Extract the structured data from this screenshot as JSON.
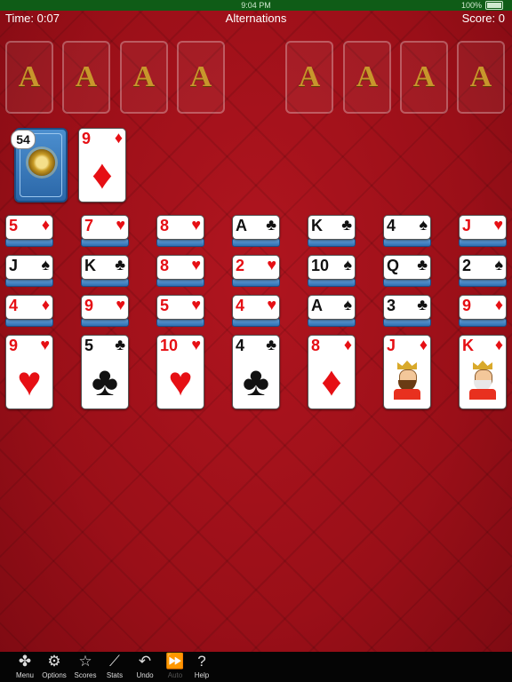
{
  "status_bar": {
    "time": "9:04 PM",
    "battery": "100%"
  },
  "header": {
    "time": "Time: 0:07",
    "title": "Alternations",
    "score": "Score: 0"
  },
  "foundations": [
    "A",
    "A",
    "A",
    "A",
    "A",
    "A",
    "A",
    "A"
  ],
  "stock": {
    "count": "54"
  },
  "waste": {
    "rank": "9",
    "suit": "♦",
    "color": "red"
  },
  "tableau": [
    {
      "cards": [
        {
          "rank": "5",
          "suit": "♦",
          "color": "red"
        },
        {
          "rank": "J",
          "suit": "♠",
          "color": "black"
        },
        {
          "rank": "4",
          "suit": "♦",
          "color": "red"
        },
        {
          "rank": "9",
          "suit": "♥",
          "color": "red"
        }
      ]
    },
    {
      "cards": [
        {
          "rank": "7",
          "suit": "♥",
          "color": "red"
        },
        {
          "rank": "K",
          "suit": "♣",
          "color": "black"
        },
        {
          "rank": "9",
          "suit": "♥",
          "color": "red"
        },
        {
          "rank": "5",
          "suit": "♣",
          "color": "black"
        }
      ]
    },
    {
      "cards": [
        {
          "rank": "8",
          "suit": "♥",
          "color": "red"
        },
        {
          "rank": "8",
          "suit": "♥",
          "color": "red"
        },
        {
          "rank": "5",
          "suit": "♥",
          "color": "red"
        },
        {
          "rank": "10",
          "suit": "♥",
          "color": "red"
        }
      ]
    },
    {
      "cards": [
        {
          "rank": "A",
          "suit": "♣",
          "color": "black"
        },
        {
          "rank": "2",
          "suit": "♥",
          "color": "red"
        },
        {
          "rank": "4",
          "suit": "♥",
          "color": "red"
        },
        {
          "rank": "4",
          "suit": "♣",
          "color": "black"
        }
      ]
    },
    {
      "cards": [
        {
          "rank": "K",
          "suit": "♣",
          "color": "black"
        },
        {
          "rank": "10",
          "suit": "♠",
          "color": "black"
        },
        {
          "rank": "A",
          "suit": "♠",
          "color": "black"
        },
        {
          "rank": "8",
          "suit": "♦",
          "color": "red"
        }
      ]
    },
    {
      "cards": [
        {
          "rank": "4",
          "suit": "♠",
          "color": "black"
        },
        {
          "rank": "Q",
          "suit": "♣",
          "color": "black"
        },
        {
          "rank": "3",
          "suit": "♣",
          "color": "black"
        },
        {
          "rank": "J",
          "suit": "♦",
          "color": "red",
          "face": "jack"
        }
      ]
    },
    {
      "cards": [
        {
          "rank": "J",
          "suit": "♥",
          "color": "red"
        },
        {
          "rank": "2",
          "suit": "♠",
          "color": "black"
        },
        {
          "rank": "9",
          "suit": "♦",
          "color": "red"
        },
        {
          "rank": "K",
          "suit": "♦",
          "color": "red",
          "face": "king"
        }
      ]
    }
  ],
  "toolbar": [
    {
      "label": "Menu",
      "icon": "menu-icon",
      "glyph": "✤",
      "enabled": true
    },
    {
      "label": "Options",
      "icon": "gear-icon",
      "glyph": "⚙",
      "enabled": true
    },
    {
      "label": "Scores",
      "icon": "star-icon",
      "glyph": "☆",
      "enabled": true
    },
    {
      "label": "Stats",
      "icon": "chart-icon",
      "glyph": "⟋",
      "enabled": true
    },
    {
      "label": "Undo",
      "icon": "undo-icon",
      "glyph": "↶",
      "enabled": true
    },
    {
      "label": "Auto",
      "icon": "fast-forward-icon",
      "glyph": "⏩",
      "enabled": false
    },
    {
      "label": "Help",
      "icon": "help-icon",
      "glyph": "?",
      "enabled": true
    }
  ],
  "colors": {
    "table": "#9d1119",
    "accent_gold": "#c8962c",
    "card_red": "#e60f14",
    "card_back": "#2f6eb0"
  }
}
